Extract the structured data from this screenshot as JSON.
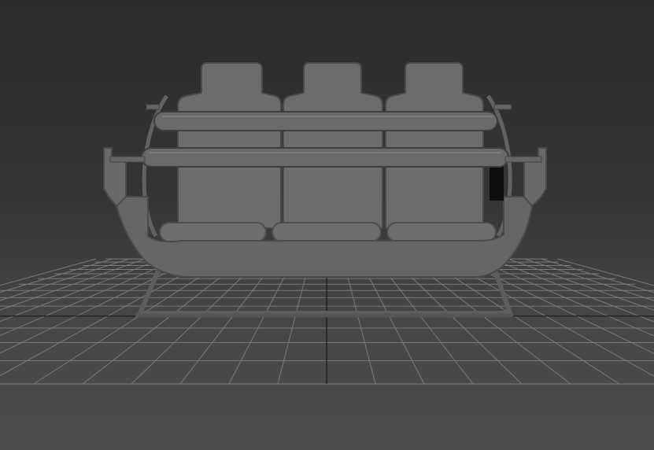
{
  "viewport": {
    "kind": "3d-perspective-viewport",
    "background_top": "#2b2b2b",
    "background_bottom": "#4d4d4d",
    "grid_color": "#7a7a7a",
    "grid_axis_color": "#0a0a0a",
    "model_color": "#6f6f6f",
    "model_shadow": "#4c4c4c",
    "model_highlight": "#858585"
  },
  "model": {
    "name": "ride-seat-gondola",
    "seat_count": 3
  }
}
